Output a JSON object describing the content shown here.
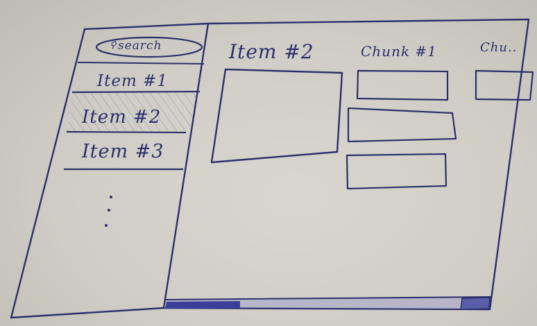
{
  "search": {
    "label": "search",
    "icon": "search-icon"
  },
  "sidebar": {
    "items": [
      {
        "label": "Item #1",
        "selected": false
      },
      {
        "label": "Item #2",
        "selected": true
      },
      {
        "label": "Item #3",
        "selected": false
      }
    ],
    "more_indicator": ":"
  },
  "main": {
    "title": "Item #2",
    "chunk_headers": [
      "Chunk #1",
      "Chu.."
    ]
  },
  "colors": {
    "ink": "#2c2f6c",
    "paper": "#d3d1ca",
    "scrollbar_thumb": "#3b3f9a"
  }
}
